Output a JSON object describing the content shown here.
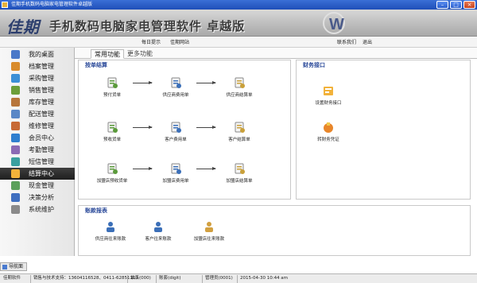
{
  "window": {
    "title": "佳期手机数码电脑家电管理软件卓越版"
  },
  "banner": {
    "brand": "佳期",
    "app_name": "手机数码电脑家电管理软件  卓越版"
  },
  "subbar": {
    "daily_tip": "每日提示",
    "website": "佳期网站",
    "contact": "联系我们",
    "exit": "退出"
  },
  "sidebar": {
    "items": [
      {
        "label": "我的桌面",
        "color": "#4a78c8"
      },
      {
        "label": "档案管理",
        "color": "#d98b2b"
      },
      {
        "label": "采购管理",
        "color": "#3b8fd6"
      },
      {
        "label": "销售管理",
        "color": "#6b9e3a"
      },
      {
        "label": "库存管理",
        "color": "#b7763b"
      },
      {
        "label": "配送管理",
        "color": "#5a87c6"
      },
      {
        "label": "维修管理",
        "color": "#c76a36"
      },
      {
        "label": "会员中心",
        "color": "#2f7fcf"
      },
      {
        "label": "考勤管理",
        "color": "#8b6bb5"
      },
      {
        "label": "短信管理",
        "color": "#3aa0a0"
      },
      {
        "label": "结算中心",
        "color": "#f2b23a",
        "active": true
      },
      {
        "label": "现金管理",
        "color": "#5aa05a"
      },
      {
        "label": "决策分析",
        "color": "#3f6fc0"
      },
      {
        "label": "系统维护",
        "color": "#8a8a8a"
      }
    ]
  },
  "tabs": [
    {
      "label": "常用功能",
      "active": true
    },
    {
      "label": "更多功能",
      "active": false
    }
  ],
  "settlement": {
    "title": "按单结算",
    "rows": [
      [
        "预付货单",
        "供应商费用单",
        "供应商结算单"
      ],
      [
        "预收货单",
        "客户费用单",
        "客户结算单"
      ],
      [
        "加盟店预收货单",
        "加盟店费用单",
        "加盟店结算单"
      ]
    ]
  },
  "finance": {
    "title": "财务接口",
    "items": [
      "设置财务接口",
      "转财务凭证"
    ]
  },
  "account": {
    "title": "账款报表",
    "items": [
      "供应商往来账款",
      "客户往来账款",
      "加盟店往来账款"
    ]
  },
  "footer": {
    "tab_label": "导航面",
    "status": [
      "佳期软件",
      "销售与技术支持：13604116528、0411-62851113",
      "单店(000)",
      "账套(digit)",
      "管理员(0001)",
      "2015-04-30 10:44 am"
    ]
  },
  "colors": {
    "accent": "#2b4a9a",
    "active_nav": "#1f1f1f"
  }
}
